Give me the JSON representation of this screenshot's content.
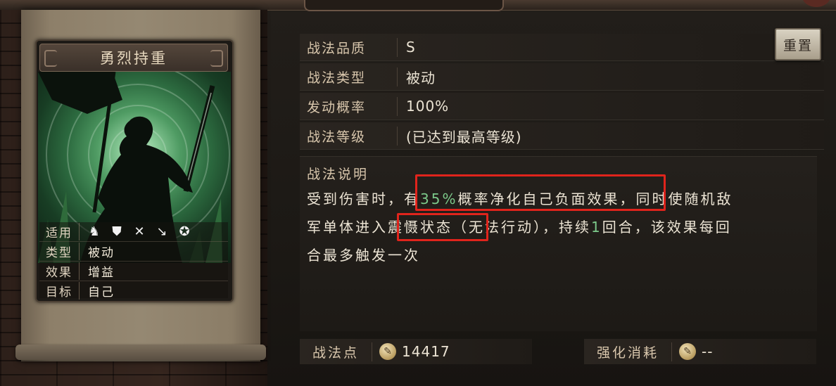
{
  "card": {
    "title": "勇烈持重",
    "info": [
      {
        "label": "适用",
        "value": ""
      },
      {
        "label": "类型",
        "value": "被动"
      },
      {
        "label": "效果",
        "value": "增益"
      },
      {
        "label": "目标",
        "value": "自己"
      }
    ],
    "applicable_icons": [
      "horse-icon",
      "shield-icon",
      "crossed-bows-icon",
      "spear-icon",
      "wheel-icon"
    ]
  },
  "attributes": [
    {
      "label": "战法品质",
      "value": "S"
    },
    {
      "label": "战法类型",
      "value": "被动"
    },
    {
      "label": "发动概率",
      "value": "100%"
    },
    {
      "label": "战法等级",
      "value": "(已达到最高等级)"
    }
  ],
  "reset_button": "重置",
  "description": {
    "title": "战法说明",
    "line1_pre": "受到伤害时，",
    "line1_box_a": "有",
    "line1_highlight": "35%",
    "line1_box_b": "概率净化自己负面效果",
    "line1_post": "，同时使随机敌",
    "line2_pre": "军单体进入",
    "line2_box": "震慑状态",
    "line2_mid": "（无法行动），持续",
    "line2_num": "1",
    "line2_post": "回合，该效果每回",
    "line3": "合最多触发一次"
  },
  "footer": {
    "points_label": "战法点",
    "points_value": "14417",
    "cost_label": "强化消耗",
    "cost_value": "--"
  },
  "colors": {
    "highlight": "#7cc98a",
    "annotation_box": "#e0241c"
  }
}
